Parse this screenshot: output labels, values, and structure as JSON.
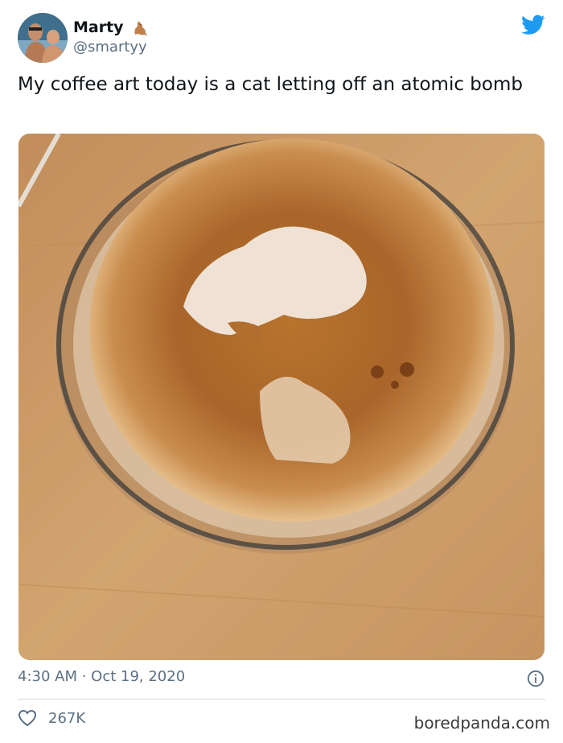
{
  "tweet": {
    "author": {
      "display_name": "Marty",
      "handle": "@smartyy",
      "name_emoji": "kangaroo-emoji"
    },
    "text": "My coffee art today is a cat letting off an atomic bomb",
    "timestamp": "4:30 AM · Oct 19, 2020",
    "likes": "267K"
  },
  "watermark": "boredpanda.com",
  "icons": {
    "brand": "twitter-bird-icon",
    "info": "info-icon",
    "like": "heart-icon"
  },
  "colors": {
    "twitter_blue": "#1d9bf0",
    "secondary_text": "#5b7083",
    "primary_text": "#0f1419"
  }
}
